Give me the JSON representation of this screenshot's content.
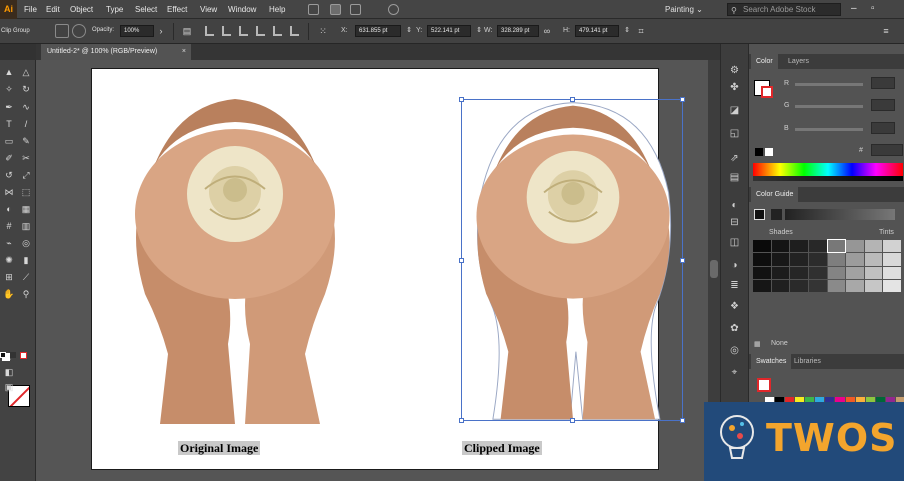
{
  "menu": {
    "app_logo": "Ai",
    "items": [
      "File",
      "Edit",
      "Object",
      "Type",
      "Select",
      "Effect",
      "View",
      "Window",
      "Help"
    ],
    "workspace": "Painting",
    "search_placeholder": "Search Adobe Stock"
  },
  "control": {
    "selection_label": "Clip Group",
    "opacity_label": "Opacity:",
    "opacity_value": "100%",
    "x_label": "X:",
    "x_value": "631.855 pt",
    "y_label": "Y:",
    "y_value": "522.141 pt",
    "w_label": "W:",
    "w_value": "328.289 pt",
    "h_label": "H:",
    "h_value": "479.141 pt"
  },
  "document": {
    "tab_title": "Untitled-2* @ 100% (RGB/Preview)",
    "close": "×"
  },
  "artboard": {
    "caption_left": "Original Image",
    "caption_right": "Clipped Image"
  },
  "panels": {
    "color": {
      "tabs": [
        "Color",
        "Layers"
      ],
      "slider_labels": [
        "R",
        "G",
        "B"
      ],
      "hash": "#"
    },
    "color_guide": {
      "title": "Color Guide",
      "shades_label": "Shades",
      "tints_label": "Tints",
      "none_label": "None"
    },
    "swatches": {
      "tabs": [
        "Swatches",
        "Libraries"
      ]
    }
  },
  "watermark": {
    "text": "TWOS"
  },
  "colors": {
    "accent": "#ff9a00",
    "selection": "#4a72c8",
    "menubar": "#454545",
    "canvas": "#555555",
    "panel": "#535353"
  }
}
